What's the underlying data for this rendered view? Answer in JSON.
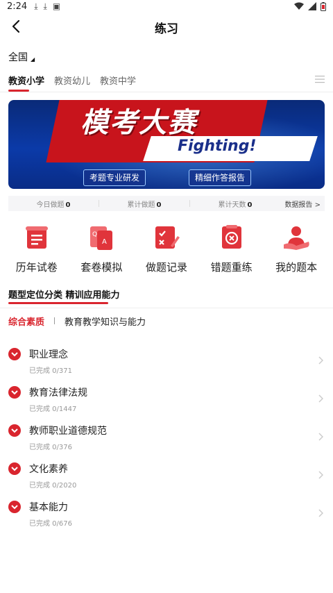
{
  "statusbar": {
    "time": "2:24"
  },
  "navbar": {
    "title": "练习"
  },
  "region": {
    "label": "全国"
  },
  "tabs": [
    {
      "label": "教资小学",
      "active": true
    },
    {
      "label": "教资幼儿",
      "active": false
    },
    {
      "label": "教资中学",
      "active": false
    }
  ],
  "banner": {
    "headline": "模考大赛",
    "slogan": "Fighting!",
    "button1": "考题专业研发",
    "button2": "精细作答报告"
  },
  "stats": {
    "today_label": "今日做题",
    "today_value": "0",
    "total_label": "累计做题",
    "total_value": "0",
    "days_label": "累计天数",
    "days_value": "0",
    "report_label": "数据报告 >"
  },
  "features": [
    {
      "label": "历年试卷",
      "icon": "scroll-paper-icon"
    },
    {
      "label": "套卷模拟",
      "icon": "qa-cards-icon"
    },
    {
      "label": "做题记录",
      "icon": "check-record-icon"
    },
    {
      "label": "错题重练",
      "icon": "wrong-question-icon"
    },
    {
      "label": "我的题本",
      "icon": "my-book-hand-icon"
    }
  ],
  "section": {
    "title": "题型定位分类 精训应用能力"
  },
  "subtabs": {
    "active": "综合素质",
    "other": "教育教学知识与能力"
  },
  "items": [
    {
      "name": "职业理念",
      "progress": "已完成 0/371"
    },
    {
      "name": "教育法律法规",
      "progress": "已完成 0/1447"
    },
    {
      "name": "教师职业道德规范",
      "progress": "已完成 0/376"
    },
    {
      "name": "文化素养",
      "progress": "已完成 0/2020"
    },
    {
      "name": "基本能力",
      "progress": "已完成 0/676"
    }
  ],
  "colors": {
    "accent": "#d9252e",
    "banner_blue": "#0b3aa8"
  }
}
